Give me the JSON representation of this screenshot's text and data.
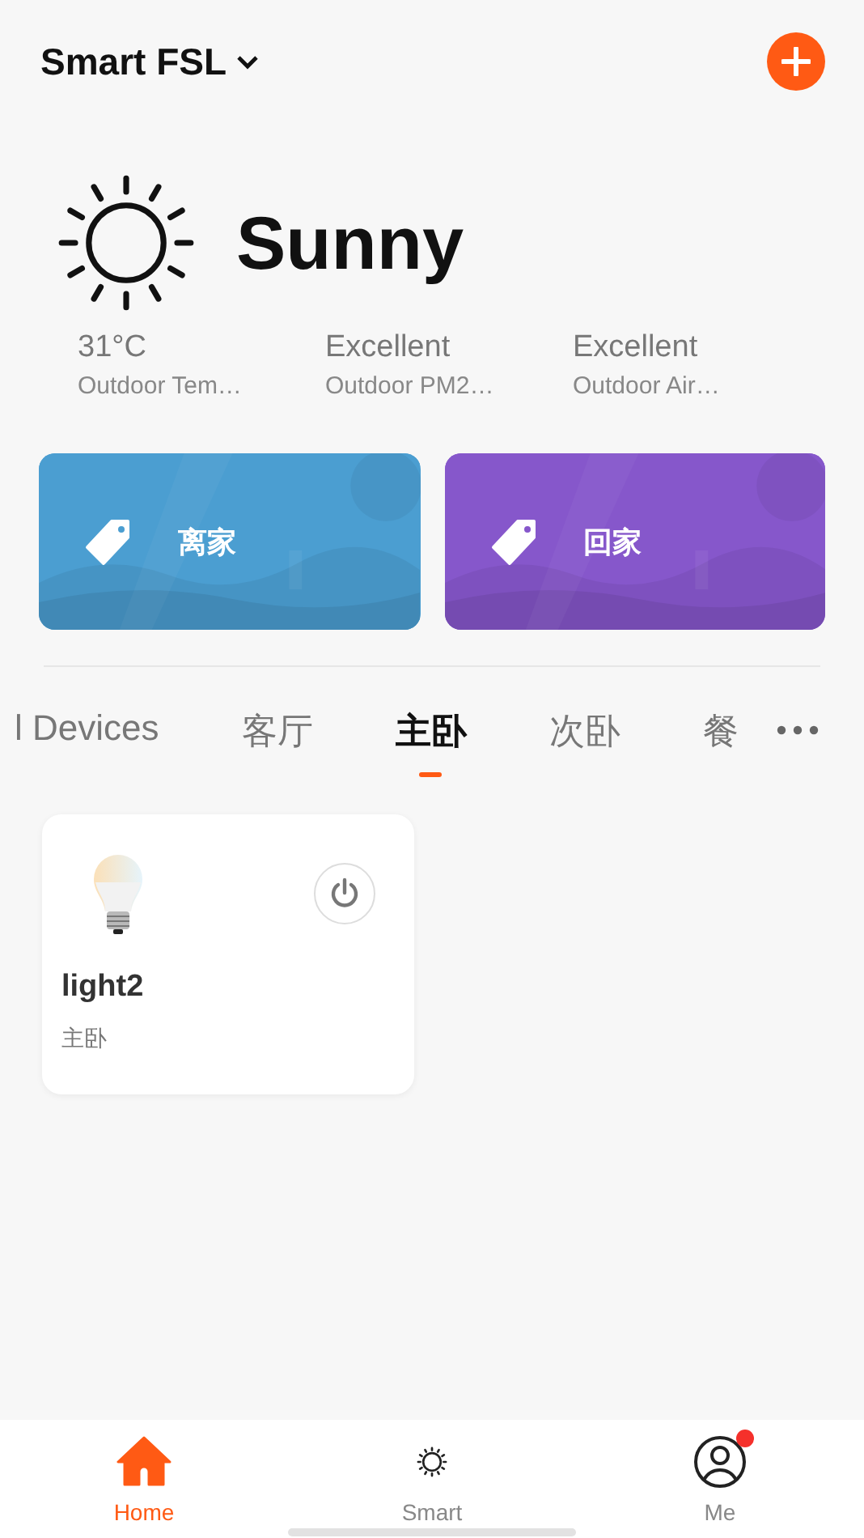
{
  "header": {
    "home_name": "Smart FSL"
  },
  "weather": {
    "condition": "Sunny",
    "stats": [
      {
        "value": "31°C",
        "label": "Outdoor Tem…"
      },
      {
        "value": "Excellent",
        "label": "Outdoor PM2…"
      },
      {
        "value": "Excellent",
        "label": "Outdoor Air…"
      }
    ]
  },
  "scenes": [
    {
      "name": "离家",
      "color": "#4b9ed1"
    },
    {
      "name": "回家",
      "color": "#8657cb"
    }
  ],
  "room_tabs": [
    {
      "label": "l Devices",
      "selected": false
    },
    {
      "label": "客厅",
      "selected": false
    },
    {
      "label": "主卧",
      "selected": true
    },
    {
      "label": "次卧",
      "selected": false
    },
    {
      "label": "餐",
      "selected": false
    }
  ],
  "devices": [
    {
      "name": "light2",
      "room": "主卧",
      "on": false
    }
  ],
  "bottom_nav": [
    {
      "label": "Home",
      "kind": "home",
      "selected": true,
      "badge": false
    },
    {
      "label": "Smart",
      "kind": "smart",
      "selected": false,
      "badge": false
    },
    {
      "label": "Me",
      "kind": "me",
      "selected": false,
      "badge": true
    }
  ]
}
